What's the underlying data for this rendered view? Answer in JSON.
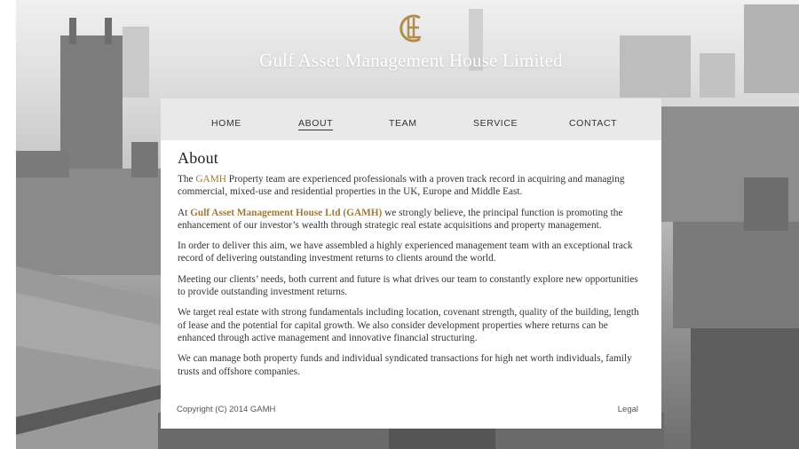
{
  "header": {
    "logo_icon": "gamh-monogram-icon",
    "title": "Gulf Asset Management House Limited",
    "accent_color": "#b08d4f"
  },
  "nav": {
    "items": [
      {
        "label": "HOME"
      },
      {
        "label": "ABOUT"
      },
      {
        "label": "TEAM"
      },
      {
        "label": "SERVICE"
      },
      {
        "label": "CONTACT"
      }
    ],
    "active": "ABOUT"
  },
  "main": {
    "heading": "About",
    "p1": {
      "pre": "The ",
      "highlight": "GAMH",
      "post": " Property team are experienced professionals with a proven track record in acquiring and managing commercial, mixed-use and residential properties in the UK, Europe and Middle East."
    },
    "p2": {
      "pre": "At ",
      "highlight": "Gulf Asset Management House Ltd (GAMH)",
      "post": " we strongly believe, the principal function is promoting the enhancement of our investor’s wealth through strategic real estate acquisitions and property management."
    },
    "p3": "In order to deliver this aim, we have assembled a highly experienced management team with an exceptional track record of delivering outstanding investment returns to clients around the world.",
    "p4": "Meeting our clients’ needs, both current and future is what drives our team to constantly explore new opportunities to provide outstanding investment returns.",
    "p5": "We target real estate with strong fundamentals including location, covenant strength, quality of the building, length of lease and the potential for capital growth. We also consider development properties where returns can be enhanced through active management and innovative financial structuring.",
    "p6": "We can manage both property funds and individual syndicated transactions for high net worth individuals, family trusts and offshore companies."
  },
  "footer": {
    "copyright": "Copyright (C) 2014 GAMH",
    "legal": "Legal"
  }
}
